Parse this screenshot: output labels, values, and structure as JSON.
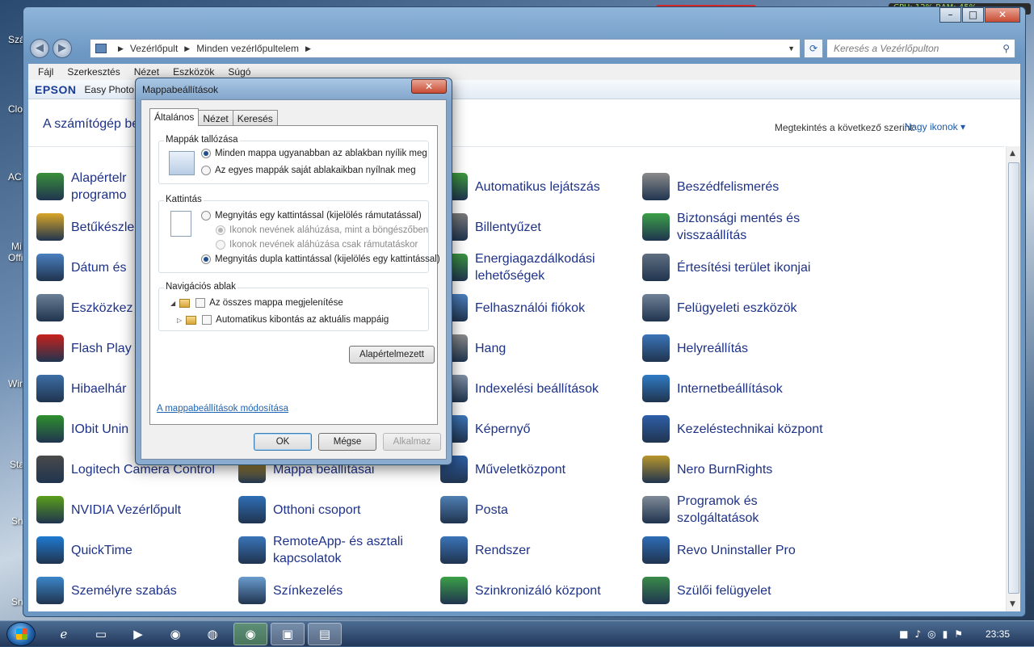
{
  "desktop": {
    "labels": [
      "Szá",
      "Clo",
      "ACI",
      "Mi",
      "Offi",
      "Win",
      "Sta",
      "Sn",
      "Sn"
    ],
    "gadget": "CPU: 12%   RAM: 45%",
    "banner": "szer"
  },
  "window": {
    "caption": {
      "minimize": "–",
      "maximize": "□",
      "close": "✕"
    },
    "nav": {
      "back": "◀",
      "forward": "▶"
    },
    "breadcrumb": [
      "Vezérlőpult",
      "Minden vezérlőpultelem"
    ],
    "search_placeholder": "Keresés a Vezérlőpulton",
    "menu": [
      "Fájl",
      "Szerkesztés",
      "Nézet",
      "Eszközök",
      "Súgó"
    ],
    "toolbar": {
      "brand": "EPSON",
      "app": "Easy Photo P"
    },
    "header": {
      "title": "A számítógép be",
      "view_label": "Megtekintés a következő szerint:",
      "view_value": "Nagy ikonok ▾"
    }
  },
  "items": [
    {
      "label": "Alapértelr\nprogramo",
      "icon": "default-programs-icon",
      "color": "#3a8f3a"
    },
    {
      "label": "Betűkészle",
      "icon": "fonts-icon",
      "color": "#d9a528"
    },
    {
      "label": "Dátum és",
      "icon": "date-time-icon",
      "color": "#4a7fbf"
    },
    {
      "label": "Eszközkez",
      "icon": "device-manager-icon",
      "color": "#6b7f96"
    },
    {
      "label": "Flash Play",
      "icon": "flash-icon",
      "color": "#c8211b"
    },
    {
      "label": "Hibaelhár",
      "icon": "troubleshooting-icon",
      "color": "#3d6ea6"
    },
    {
      "label": "IObit Unin",
      "icon": "iobit-icon",
      "color": "#2e8f2e"
    },
    {
      "label": "Logitech Camera Control",
      "icon": "logitech-icon",
      "color": "#4a4a4a"
    },
    {
      "label": "NVIDIA Vezérlőpult",
      "icon": "nvidia-icon",
      "color": "#5a9e1a"
    },
    {
      "label": "QuickTime",
      "icon": "quicktime-icon",
      "color": "#1f7ad1"
    },
    {
      "label": "Személyre szabás",
      "icon": "personalization-icon",
      "color": "#3b86c9"
    },
    {
      "label": "Mappa beállításai",
      "icon": "folder-options-icon",
      "color": "#d9a528"
    },
    {
      "label": "Otthoni csoport",
      "icon": "homegroup-icon",
      "color": "#2f6fb5"
    },
    {
      "label": "RemoteApp- és asztali\nkapcsolatok",
      "icon": "remoteapp-icon",
      "color": "#3a74b8"
    },
    {
      "label": "Színkezelés",
      "icon": "color-management-icon",
      "color": "#6a9ccf"
    },
    {
      "label": "Automatikus lejátszás",
      "icon": "autoplay-icon",
      "color": "#3d9a3d"
    },
    {
      "label": "Billentyűzet",
      "icon": "keyboard-icon",
      "color": "#7a7a7a"
    },
    {
      "label": "Energiagazdálkodási\nlehetőségek",
      "icon": "power-options-icon",
      "color": "#3b9440"
    },
    {
      "label": "Felhasználói fiókok",
      "icon": "user-accounts-icon",
      "color": "#4a7fbf"
    },
    {
      "label": "Hang",
      "icon": "sound-icon",
      "color": "#8a8a8a"
    },
    {
      "label": "Indexelési beállítások",
      "icon": "indexing-icon",
      "color": "#7f8fa3"
    },
    {
      "label": "Képernyő",
      "icon": "display-icon",
      "color": "#3a74b8"
    },
    {
      "label": "Műveletközpont",
      "icon": "action-center-icon",
      "color": "#2d5fa6"
    },
    {
      "label": "Posta",
      "icon": "mail-icon",
      "color": "#4f7fb3"
    },
    {
      "label": "Rendszer",
      "icon": "system-icon",
      "color": "#3a74b8"
    },
    {
      "label": "Szinkronizáló központ",
      "icon": "sync-center-icon",
      "color": "#3ba047"
    },
    {
      "label": "Beszédfelismerés",
      "icon": "microphone-icon",
      "color": "#8a8a8a"
    },
    {
      "label": "Biztonsági mentés és\nvisszaállítás",
      "icon": "backup-icon",
      "color": "#3ba047"
    },
    {
      "label": "Értesítési terület ikonjai",
      "icon": "notification-icons-icon",
      "color": "#5f6f80"
    },
    {
      "label": "Felügyeleti eszközök",
      "icon": "admin-tools-icon",
      "color": "#6f8296"
    },
    {
      "label": "Helyreállítás",
      "icon": "recovery-icon",
      "color": "#3a74b8"
    },
    {
      "label": "Internetbeállítások",
      "icon": "internet-options-icon",
      "color": "#2f7bc4"
    },
    {
      "label": "Kezeléstechnikai központ",
      "icon": "ease-of-access-icon",
      "color": "#2e5fa8"
    },
    {
      "label": "Nero BurnRights",
      "icon": "nero-icon",
      "color": "#b8962b"
    },
    {
      "label": "Programok és\nszolgáltatások",
      "icon": "programs-features-icon",
      "color": "#7f8a96"
    },
    {
      "label": "Revo Uninstaller Pro",
      "icon": "revo-icon",
      "color": "#2d6cb5"
    },
    {
      "label": "Szülői felügyelet",
      "icon": "parental-controls-icon",
      "color": "#3a8a4a"
    }
  ],
  "dialog": {
    "title": "Mappabeállítások",
    "close": "✕",
    "tabs": [
      "Általános",
      "Nézet",
      "Keresés"
    ],
    "browse": {
      "title": "Mappák tallózása",
      "opt1": "Minden mappa ugyanabban az ablakban nyílik meg",
      "opt2": "Az egyes mappák saját ablakaikban nyílnak meg"
    },
    "click": {
      "title": "Kattintás",
      "opt1": "Megnyitás egy kattintással (kijelölés rámutatással)",
      "sub1": "Ikonok nevének aláhúzása, mint a böngészőben",
      "sub2": "Ikonok nevének aláhúzása csak rámutatáskor",
      "opt2": "Megnyitás dupla kattintással (kijelölés egy kattintással)"
    },
    "nav": {
      "title": "Navigációs ablak",
      "chk1": "Az összes mappa megjelenítése",
      "chk2": "Automatikus kibontás az aktuális mappáig"
    },
    "restore_button": "Alapértelmezett",
    "help_link": "A mappabeállítások módosítása",
    "ok": "OK",
    "cancel": "Mégse",
    "apply": "Alkalmaz"
  },
  "taskbar": {
    "clock": "23:35",
    "buttons": [
      "ie-icon",
      "explorer-icon",
      "media-player-icon",
      "firefox-icon",
      "chrome-icon",
      "firefox-active-icon",
      "control-panel-icon",
      "folder-options-icon"
    ]
  }
}
